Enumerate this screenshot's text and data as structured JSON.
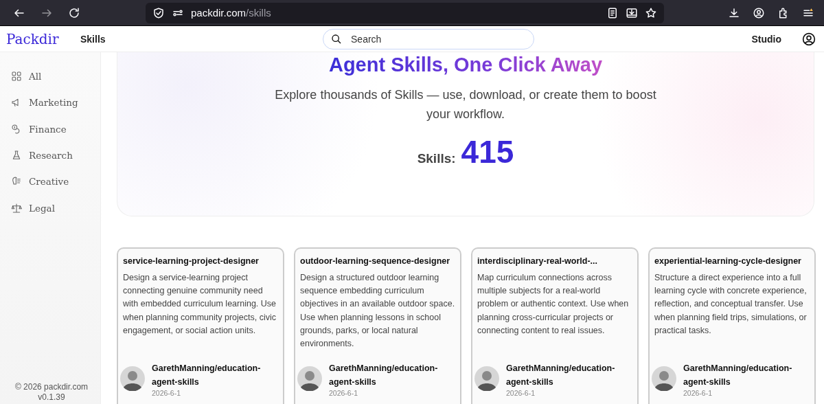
{
  "browser": {
    "url_host": "packdir.com",
    "url_path": "/skills"
  },
  "header": {
    "logo": "Packdir",
    "nav": [
      {
        "label": "Skills"
      }
    ],
    "search": {
      "placeholder": "Search"
    },
    "studio": "Studio"
  },
  "sidebar": {
    "items": [
      {
        "label": "All"
      },
      {
        "label": "Marketing"
      },
      {
        "label": "Finance"
      },
      {
        "label": "Research"
      },
      {
        "label": "Creative"
      },
      {
        "label": "Legal"
      }
    ],
    "copyright": "© 2026 packdir.com",
    "version": "v0.1.39"
  },
  "hero": {
    "title": "Agent Skills, One Click Away",
    "subtitle": "Explore thousands of Skills — use, download, or create them to boost your workflow.",
    "count_label": "Skills:",
    "count": "415"
  },
  "skills": [
    {
      "name": "service-learning-project-designer",
      "description": "Design a service-learning project connecting genuine community need with embedded curriculum learning. Use when planning community projects, civic engagement, or social action units.",
      "author": "GarethManning/education-agent-skills",
      "date": "2026-6-1"
    },
    {
      "name": "outdoor-learning-sequence-designer",
      "description": "Design a structured outdoor learning sequence embedding curriculum objectives in an available outdoor space. Use when planning lessons in school grounds, parks, or local natural environments.",
      "author": "GarethManning/education-agent-skills",
      "date": "2026-6-1"
    },
    {
      "name": "interdisciplinary-real-world-...",
      "description": "Map curriculum connections across multiple subjects for a real-world problem or authentic context. Use when planning cross-curricular projects or connecting content to real issues.",
      "author": "GarethManning/education-agent-skills",
      "date": "2026-6-1"
    },
    {
      "name": "experiential-learning-cycle-designer",
      "description": "Structure a direct experience into a full learning cycle with concrete experience, reflection, and conceptual transfer. Use when planning field trips, simulations, or practical tasks.",
      "author": "GarethManning/education-agent-skills",
      "date": "2026-6-1"
    }
  ]
}
